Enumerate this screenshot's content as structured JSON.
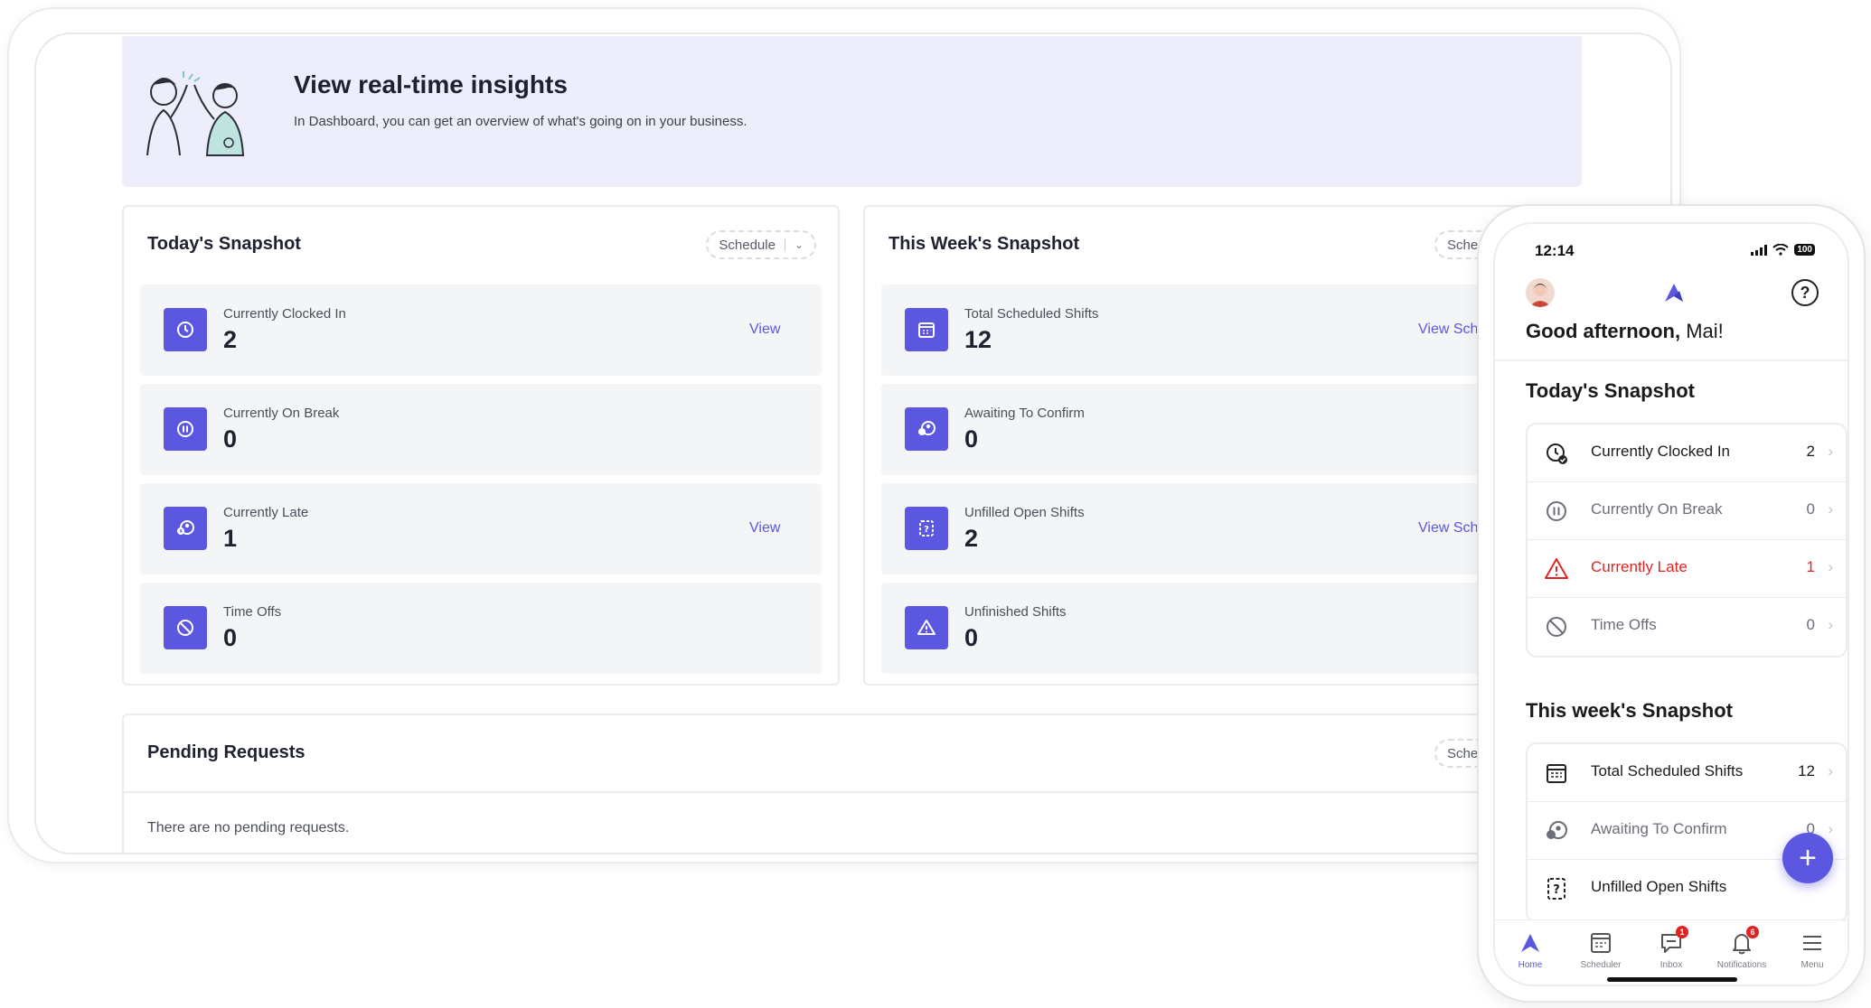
{
  "banner": {
    "title": "View real-time insights",
    "subtitle": "In Dashboard, you can get an overview of what's going on in your business."
  },
  "today_card": {
    "title": "Today's Snapshot",
    "filter_label": "Schedule",
    "rows": [
      {
        "label": "Currently Clocked In",
        "value": "2",
        "link": "View",
        "icon": "clock-icon"
      },
      {
        "label": "Currently On Break",
        "value": "0",
        "link": "",
        "icon": "pause-icon"
      },
      {
        "label": "Currently Late",
        "value": "1",
        "link": "View",
        "icon": "late-icon"
      },
      {
        "label": "Time Offs",
        "value": "0",
        "link": "",
        "icon": "blocked-icon"
      }
    ]
  },
  "week_card": {
    "title": "This Week's Snapshot",
    "filter_label": "Sched",
    "rows": [
      {
        "label": "Total Scheduled Shifts",
        "value": "12",
        "link": "View Sched",
        "icon": "calendar-icon"
      },
      {
        "label": "Awaiting To Confirm",
        "value": "0",
        "link": "",
        "icon": "users-icon"
      },
      {
        "label": "Unfilled Open Shifts",
        "value": "2",
        "link": "View Sched",
        "icon": "question-box-icon"
      },
      {
        "label": "Unfinished Shifts",
        "value": "0",
        "link": "",
        "icon": "warning-icon"
      }
    ]
  },
  "pending_card": {
    "title": "Pending Requests",
    "filter_label": "Sched",
    "empty_text": "There are no pending requests."
  },
  "phone": {
    "time": "12:14",
    "battery": "100",
    "greeting_prefix": "Good afternoon,",
    "greeting_name": " Mai!",
    "today_title": "Today's Snapshot",
    "today_items": [
      {
        "label": "Currently Clocked In",
        "value": "2",
        "icon": "clock-check-icon",
        "style": "normal"
      },
      {
        "label": "Currently On Break",
        "value": "0",
        "icon": "pause-icon",
        "style": "muted"
      },
      {
        "label": "Currently Late",
        "value": "1",
        "icon": "warning-icon",
        "style": "alert"
      },
      {
        "label": "Time Offs",
        "value": "0",
        "icon": "blocked-icon",
        "style": "muted"
      }
    ],
    "week_title": "This week's Snapshot",
    "week_items": [
      {
        "label": "Total Scheduled Shifts",
        "value": "12",
        "icon": "calendar-icon",
        "style": "normal"
      },
      {
        "label": "Awaiting To Confirm",
        "value": "0",
        "icon": "users-icon",
        "style": "muted"
      },
      {
        "label": "Unfilled Open Shifts",
        "value": "",
        "icon": "question-box-icon",
        "style": "normal"
      }
    ],
    "tabs": [
      {
        "label": "Home",
        "icon": "home-icon",
        "badge": "",
        "active": true
      },
      {
        "label": "Scheduler",
        "icon": "scheduler-icon",
        "badge": "",
        "active": false
      },
      {
        "label": "Inbox",
        "icon": "inbox-icon",
        "badge": "1",
        "active": false
      },
      {
        "label": "Notifications",
        "icon": "bell-icon",
        "badge": "6",
        "active": false
      },
      {
        "label": "Menu",
        "icon": "menu-icon",
        "badge": "",
        "active": false
      }
    ],
    "fab_label": "+"
  },
  "colors": {
    "accent": "#5b57e0",
    "banner_bg": "#eeedfc",
    "alert": "#e02424",
    "row_bg": "#f4f5f7"
  }
}
